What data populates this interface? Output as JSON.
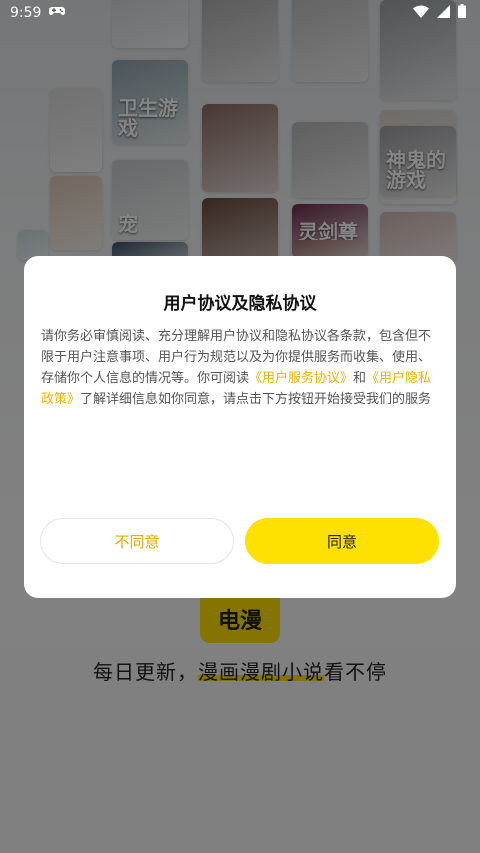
{
  "status_bar": {
    "time": "9:59",
    "icons": [
      "gamepad-icon",
      "wifi-icon",
      "signal-icon",
      "battery-icon"
    ]
  },
  "background": {
    "covers": [
      {
        "text": "",
        "color": "#cfd3d6"
      },
      {
        "text": "",
        "color": "#a9a9a9"
      },
      {
        "text": "",
        "color": "#bdbdbd"
      },
      {
        "text": "",
        "color": "#9aa2a6"
      },
      {
        "text": "",
        "color": "#d8d8d8"
      },
      {
        "text": "卫生游戏",
        "color": "#8fa3ad"
      },
      {
        "text": "",
        "color": "#8c6c62"
      },
      {
        "text": "",
        "color": "#b7b7b7"
      },
      {
        "text": "",
        "color": "#d4cfc8"
      },
      {
        "text": "宠",
        "color": "#c7c9cb"
      },
      {
        "text": "",
        "color": "#6b4a3a"
      },
      {
        "text": "灵剑尊",
        "color": "#6d2b4a"
      },
      {
        "text": "神鬼的游戏",
        "color": "#9e9ea3"
      },
      {
        "text": "",
        "color": "#d9c7b3"
      },
      {
        "text": "",
        "color": "#3a5066"
      },
      {
        "text": "",
        "color": "#8b4b3e"
      },
      {
        "text": "",
        "color": "#9b6c6a"
      },
      {
        "text": "",
        "color": "#cfb6b0"
      },
      {
        "text": "",
        "color": "#c9d8de"
      }
    ],
    "logo_text": "电漫",
    "slogan_prefix": "每日更新，",
    "slogan_highlight": "漫画漫剧小说",
    "slogan_suffix": "看不停"
  },
  "dialog": {
    "title": "用户协议及隐私协议",
    "body_part1": "请你务必审慎阅读、充分理解用户协议和隐私协议各条款，包含但不限于用户注意事项、用户行为规范以及为你提供服务而收集、使用、存储你个人信息的情况等。你可阅读",
    "link_service": "《用户服务协议》",
    "body_and": "和",
    "link_privacy": "《用户隐私政策》",
    "body_part2": "了解详细信息如你同意，请点击下方按钮开始接受我们的服务",
    "disagree_label": "不同意",
    "agree_label": "同意"
  },
  "colors": {
    "accent": "#ffe100",
    "link": "#f0b400"
  }
}
